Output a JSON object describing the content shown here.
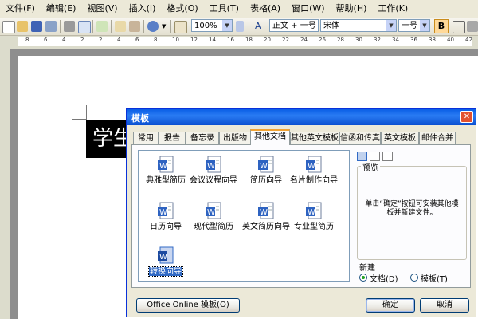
{
  "menu": [
    "文件(F)",
    "编辑(E)",
    "视图(V)",
    "插入(I)",
    "格式(O)",
    "工具(T)",
    "表格(A)",
    "窗口(W)",
    "帮助(H)",
    "工作(K)"
  ],
  "toolbar": {
    "zoom": "100%",
    "style": "正文 + 一号",
    "font": "宋体",
    "size": "一号",
    "bold": "B"
  },
  "ruler": {
    "ticks": [
      "8",
      "6",
      "4",
      "2",
      "2",
      "4",
      "6",
      "8",
      "10",
      "12",
      "14",
      "16",
      "18",
      "20",
      "22",
      "24",
      "26",
      "28",
      "30",
      "32",
      "34",
      "36",
      "38",
      "40",
      "42"
    ]
  },
  "document": {
    "title_fragment": "学生"
  },
  "dialog": {
    "title": "模板",
    "tabs": [
      "常用",
      "报告",
      "备忘录",
      "出版物",
      "其他文档",
      "其他英文模板",
      "信函和传真",
      "英文模板",
      "邮件合并"
    ],
    "active_tab": "其他文档",
    "templates": [
      {
        "label": "典雅型简历"
      },
      {
        "label": "会议议程向导"
      },
      {
        "label": "简历向导"
      },
      {
        "label": "名片制作向导"
      },
      {
        "label": "日历向导"
      },
      {
        "label": "现代型简历"
      },
      {
        "label": "英文简历向导"
      },
      {
        "label": "专业型简历"
      },
      {
        "label": "转换向导"
      }
    ],
    "selected_template": "转换向导",
    "preview_label": "预览",
    "preview_message": "单击“确定”按钮可安装其他模板并新建文件。",
    "new_label": "新建",
    "radio_document": "文档(D)",
    "radio_template": "模板(T)",
    "office_online": "Office Online 模板(O)",
    "ok": "确定",
    "cancel": "取消"
  },
  "colors": {
    "titlebar": "#0a5ee6",
    "selection": "#316ac5",
    "close": "#e2512f"
  },
  "icons": [
    "new-doc-icon",
    "open-icon",
    "save-icon",
    "print-icon",
    "preview-icon",
    "spell-icon",
    "cut-icon",
    "copy-icon",
    "paste-icon",
    "undo-icon",
    "redo-icon",
    "zoom-icon",
    "style-icon",
    "word-template-icon"
  ]
}
